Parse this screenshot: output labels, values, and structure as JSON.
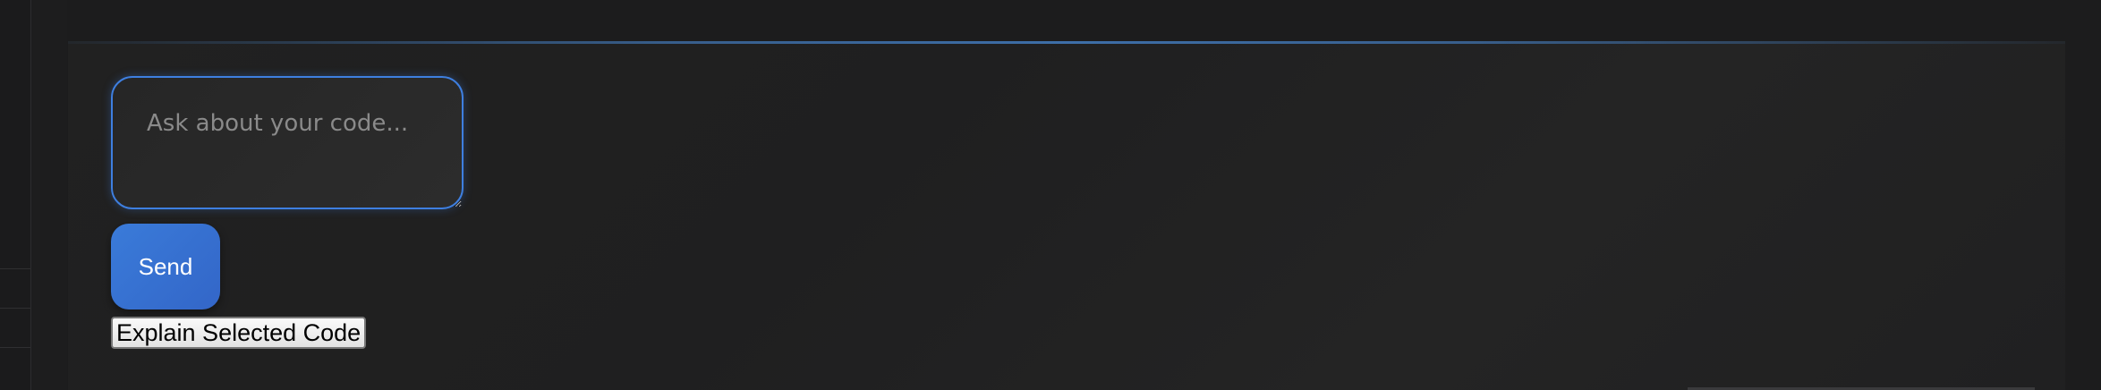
{
  "chat": {
    "input_placeholder": "Ask about your code...",
    "send_label": "Send",
    "explain_label": "Explain Selected Code"
  },
  "colors": {
    "background": "#1c1c1d",
    "accent": "#3e7fe0",
    "send_button": "#3a7bd9"
  }
}
